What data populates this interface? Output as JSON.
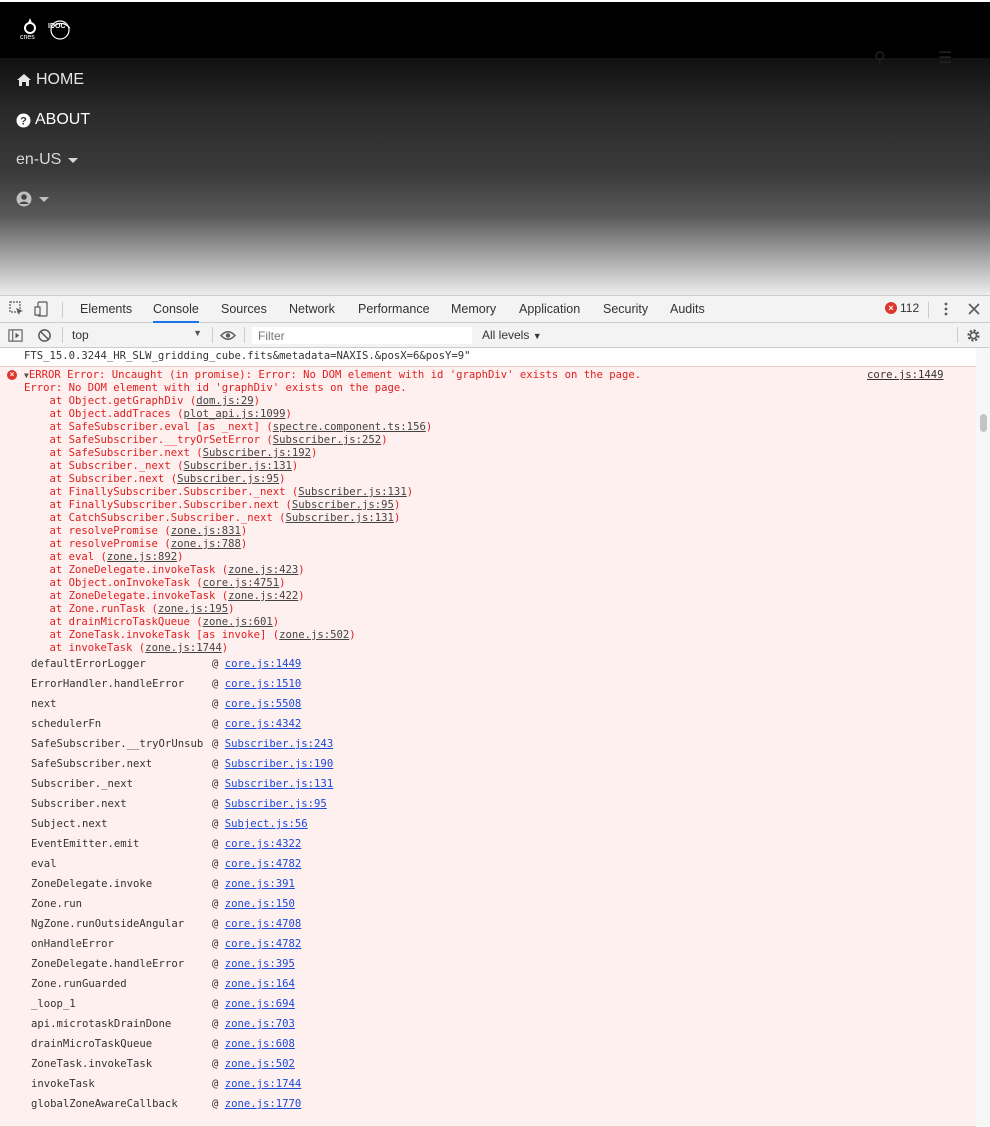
{
  "site": {
    "logo_cnes": "cnes",
    "logo_idoc": "IDOC",
    "nav": {
      "home": "HOME",
      "about": "ABOUT",
      "lang": "en-US"
    }
  },
  "devtools": {
    "tabs": [
      "Elements",
      "Console",
      "Sources",
      "Network",
      "Performance",
      "Memory",
      "Application",
      "Security",
      "Audits"
    ],
    "active_tab": "Console",
    "error_count": "112",
    "context": "top",
    "filter_placeholder": "Filter",
    "levels": "All levels"
  },
  "console": {
    "prev_line": "FTS_15.0.3244_HR_SLW_gridding_cube.fits&metadata=NAXIS.&posX=6&posY=9\"",
    "error": {
      "head": "ERROR Error: Uncaught (in promise): Error: No DOM element with id 'graphDiv' exists on the page.",
      "source": "core.js:1449",
      "message": "Error: No DOM element with id 'graphDiv' exists on the page.",
      "trace": [
        {
          "pre": "    at Object.getGraphDiv (",
          "file": "dom.js:29",
          "post": ")"
        },
        {
          "pre": "    at Object.addTraces (",
          "file": "plot_api.js:1099",
          "post": ")"
        },
        {
          "pre": "    at SafeSubscriber.eval [as _next] (",
          "file": "spectre.component.ts:156",
          "post": ")"
        },
        {
          "pre": "    at SafeSubscriber.__tryOrSetError (",
          "file": "Subscriber.js:252",
          "post": ")"
        },
        {
          "pre": "    at SafeSubscriber.next (",
          "file": "Subscriber.js:192",
          "post": ")"
        },
        {
          "pre": "    at Subscriber._next (",
          "file": "Subscriber.js:131",
          "post": ")"
        },
        {
          "pre": "    at Subscriber.next (",
          "file": "Subscriber.js:95",
          "post": ")"
        },
        {
          "pre": "    at FinallySubscriber.Subscriber._next (",
          "file": "Subscriber.js:131",
          "post": ")"
        },
        {
          "pre": "    at FinallySubscriber.Subscriber.next (",
          "file": "Subscriber.js:95",
          "post": ")"
        },
        {
          "pre": "    at CatchSubscriber.Subscriber._next (",
          "file": "Subscriber.js:131",
          "post": ")"
        },
        {
          "pre": "    at resolvePromise (",
          "file": "zone.js:831",
          "post": ")"
        },
        {
          "pre": "    at resolvePromise (",
          "file": "zone.js:788",
          "post": ")"
        },
        {
          "pre": "    at eval (",
          "file": "zone.js:892",
          "post": ")"
        },
        {
          "pre": "    at ZoneDelegate.invokeTask (",
          "file": "zone.js:423",
          "post": ")"
        },
        {
          "pre": "    at Object.onInvokeTask (",
          "file": "core.js:4751",
          "post": ")"
        },
        {
          "pre": "    at ZoneDelegate.invokeTask (",
          "file": "zone.js:422",
          "post": ")"
        },
        {
          "pre": "    at Zone.runTask (",
          "file": "zone.js:195",
          "post": ")"
        },
        {
          "pre": "    at drainMicroTaskQueue (",
          "file": "zone.js:601",
          "post": ")"
        },
        {
          "pre": "    at ZoneTask.invokeTask [as invoke] (",
          "file": "zone.js:502",
          "post": ")"
        },
        {
          "pre": "    at invokeTask (",
          "file": "zone.js:1744",
          "post": ")"
        }
      ],
      "stack": [
        {
          "fn": "defaultErrorLogger",
          "link": "core.js:1449"
        },
        {
          "fn": "ErrorHandler.handleError",
          "link": "core.js:1510"
        },
        {
          "fn": "next",
          "link": "core.js:5508"
        },
        {
          "fn": "schedulerFn",
          "link": "core.js:4342"
        },
        {
          "fn": "SafeSubscriber.__tryOrUnsub",
          "link": "Subscriber.js:243"
        },
        {
          "fn": "SafeSubscriber.next",
          "link": "Subscriber.js:190"
        },
        {
          "fn": "Subscriber._next",
          "link": "Subscriber.js:131"
        },
        {
          "fn": "Subscriber.next",
          "link": "Subscriber.js:95"
        },
        {
          "fn": "Subject.next",
          "link": "Subject.js:56"
        },
        {
          "fn": "EventEmitter.emit",
          "link": "core.js:4322"
        },
        {
          "fn": "eval",
          "link": "core.js:4782"
        },
        {
          "fn": "ZoneDelegate.invoke",
          "link": "zone.js:391"
        },
        {
          "fn": "Zone.run",
          "link": "zone.js:150"
        },
        {
          "fn": "NgZone.runOutsideAngular",
          "link": "core.js:4708"
        },
        {
          "fn": "onHandleError",
          "link": "core.js:4782"
        },
        {
          "fn": "ZoneDelegate.handleError",
          "link": "zone.js:395"
        },
        {
          "fn": "Zone.runGuarded",
          "link": "zone.js:164"
        },
        {
          "fn": "_loop_1",
          "link": "zone.js:694"
        },
        {
          "fn": "api.microtaskDrainDone",
          "link": "zone.js:703"
        },
        {
          "fn": "drainMicroTaskQueue",
          "link": "zone.js:608"
        },
        {
          "fn": "ZoneTask.invokeTask",
          "link": "zone.js:502"
        },
        {
          "fn": "invokeTask",
          "link": "zone.js:1744"
        },
        {
          "fn": "globalZoneAwareCallback",
          "link": "zone.js:1770"
        }
      ]
    }
  }
}
